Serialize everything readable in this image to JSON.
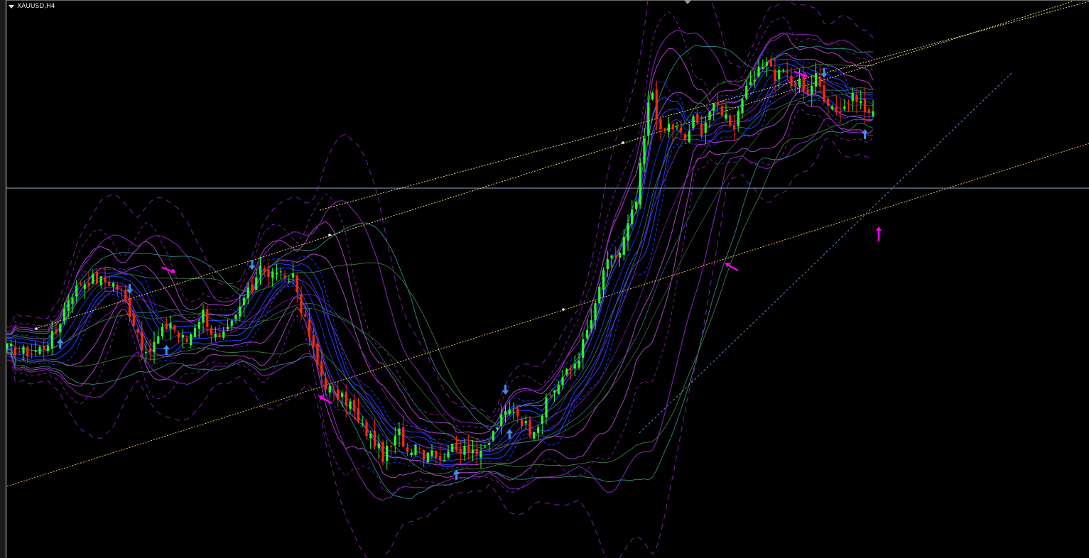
{
  "header": {
    "symbol_label": "XAUUSD,H4"
  },
  "colors": {
    "background": "#000000",
    "bull_candle": "#24ff24",
    "bear_candle": "#ff2a00",
    "buy_arrow": "#3d8fe8",
    "sell_arrow": "#3d8fe8",
    "signal_arrow": "#ff00ff",
    "channel_line": "#f0c060",
    "channel_line_upper": "#f0e070",
    "horizontal_line": "#8fa8c8",
    "trend_line": "#5a8fd8",
    "band_blue": "#1e3cff",
    "band_purple": "#7a1ea8",
    "band_magenta": "#b040d0",
    "band_teal": "#2f8a8a",
    "band_green": "#3f7a3f"
  },
  "chart_data": {
    "type": "candlestick",
    "symbol": "XAUUSD",
    "timeframe": "H4",
    "grid": false,
    "legend": "none",
    "indicators": [
      "bands",
      "channel",
      "trend_line",
      "horizontal_line",
      "signal_arrows"
    ],
    "price_path": [
      [
        0,
        0.59
      ],
      [
        3,
        0.58
      ],
      [
        6,
        0.57
      ],
      [
        9,
        0.6
      ],
      [
        12,
        0.66
      ],
      [
        15,
        0.8
      ],
      [
        18,
        0.86
      ],
      [
        21,
        0.88
      ],
      [
        24,
        0.87
      ],
      [
        26,
        0.86
      ],
      [
        28,
        0.82
      ],
      [
        30,
        0.74
      ],
      [
        32,
        0.66
      ],
      [
        34,
        0.55
      ],
      [
        36,
        0.61
      ],
      [
        38,
        0.66
      ],
      [
        40,
        0.7
      ],
      [
        42,
        0.64
      ],
      [
        44,
        0.62
      ],
      [
        46,
        0.69
      ],
      [
        48,
        0.74
      ],
      [
        50,
        0.66
      ],
      [
        52,
        0.62
      ],
      [
        54,
        0.66
      ],
      [
        56,
        0.72
      ],
      [
        58,
        0.8
      ],
      [
        60,
        0.84
      ],
      [
        62,
        0.95
      ],
      [
        64,
        0.88
      ],
      [
        66,
        0.92
      ],
      [
        68,
        0.86
      ],
      [
        70,
        0.9
      ],
      [
        72,
        0.76
      ],
      [
        74,
        0.64
      ],
      [
        76,
        0.52
      ],
      [
        78,
        0.44
      ],
      [
        80,
        0.4
      ],
      [
        82,
        0.38
      ],
      [
        84,
        0.36
      ],
      [
        86,
        0.28
      ],
      [
        88,
        0.24
      ],
      [
        90,
        0.2
      ],
      [
        92,
        0.14
      ],
      [
        94,
        0.18
      ],
      [
        96,
        0.24
      ],
      [
        98,
        0.16
      ],
      [
        100,
        0.2
      ],
      [
        102,
        0.15
      ],
      [
        104,
        0.18
      ],
      [
        106,
        0.11
      ],
      [
        108,
        0.18
      ],
      [
        110,
        0.16
      ],
      [
        112,
        0.19
      ],
      [
        114,
        0.17
      ],
      [
        116,
        0.14
      ],
      [
        118,
        0.2
      ],
      [
        120,
        0.27
      ],
      [
        122,
        0.32
      ],
      [
        124,
        0.34
      ],
      [
        126,
        0.29
      ],
      [
        128,
        0.25
      ],
      [
        130,
        0.28
      ],
      [
        132,
        0.36
      ],
      [
        134,
        0.42
      ],
      [
        136,
        0.47
      ],
      [
        138,
        0.5
      ],
      [
        140,
        0.56
      ],
      [
        142,
        0.66
      ],
      [
        144,
        0.76
      ],
      [
        146,
        0.92
      ],
      [
        148,
        0.96
      ],
      [
        150,
        0.99
      ],
      [
        152,
        1.1
      ],
      [
        154,
        1.2
      ],
      [
        155,
        1.34
      ],
      [
        156,
        1.46
      ],
      [
        157,
        1.6
      ],
      [
        158,
        1.66
      ],
      [
        160,
        1.48
      ],
      [
        162,
        1.52
      ],
      [
        164,
        1.5
      ],
      [
        166,
        1.46
      ],
      [
        168,
        1.54
      ],
      [
        170,
        1.5
      ],
      [
        172,
        1.58
      ],
      [
        174,
        1.6
      ],
      [
        176,
        1.56
      ],
      [
        178,
        1.52
      ],
      [
        180,
        1.64
      ],
      [
        182,
        1.68
      ],
      [
        184,
        1.74
      ],
      [
        186,
        1.8
      ],
      [
        188,
        1.72
      ],
      [
        190,
        1.76
      ],
      [
        192,
        1.68
      ],
      [
        194,
        1.7
      ],
      [
        196,
        1.66
      ],
      [
        198,
        1.72
      ],
      [
        200,
        1.64
      ],
      [
        202,
        1.6
      ],
      [
        204,
        1.58
      ],
      [
        206,
        1.62
      ],
      [
        208,
        1.64
      ],
      [
        210,
        1.58
      ],
      [
        212,
        1.56
      ]
    ],
    "signal_arrows": [
      {
        "bar": 13,
        "kind": "buy"
      },
      {
        "bar": 30,
        "kind": "sell"
      },
      {
        "bar": 39,
        "kind": "buy"
      },
      {
        "bar": 60,
        "kind": "sell"
      },
      {
        "bar": 110,
        "kind": "buy"
      },
      {
        "bar": 123,
        "kind": "buy"
      },
      {
        "bar": 122,
        "kind": "sell"
      },
      {
        "bar": 200,
        "kind": "sell"
      },
      {
        "bar": 210,
        "kind": "buy"
      }
    ]
  }
}
